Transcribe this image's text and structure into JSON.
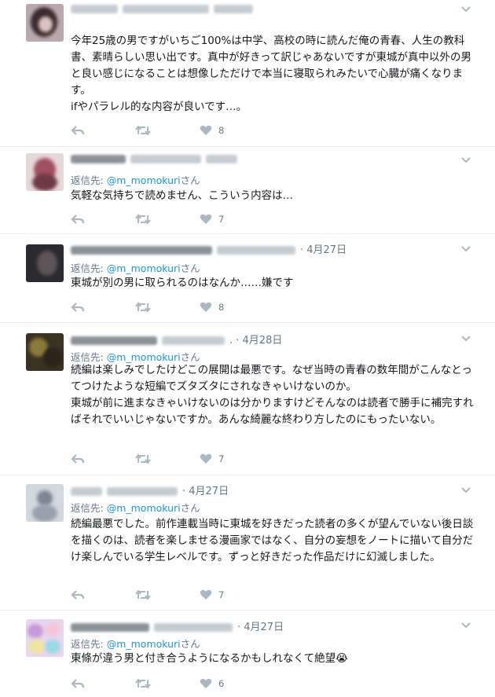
{
  "replies": [
    {
      "date": "",
      "replying_prefix": "",
      "handle": "",
      "handle_suffix": "",
      "text": "今年25歳の男ですがいちご100%は中学、高校の時に読んだ俺の青春、人生の教科書、素晴らしい思い出です。真中が好きって訳じゃあないですが東城が真中以外の男と良い感じになることは想像しただけで本当に寝取られみたいで心臓が痛くなります。\nifやパラレル的な内容が良いです…。",
      "likes": "8"
    },
    {
      "date": "",
      "replying_prefix": "返信先: ",
      "handle": "@m_momokuri",
      "handle_suffix": "さん",
      "text": "気軽な気持ちで読めません、こういう内容は…",
      "likes": "7"
    },
    {
      "date": "4月27日",
      "replying_prefix": "返信先: ",
      "handle": "@m_momokuri",
      "handle_suffix": "さん",
      "text": "東城が別の男に取られるのはなんか……嫌です",
      "likes": "8"
    },
    {
      "date": "4月28日",
      "replying_prefix": "返信先: ",
      "handle": "@m_momokuri",
      "handle_suffix": "さん",
      "text": "続編は楽しみでしたけどこの展開は最悪です。なぜ当時の青春の数年間がこんなとってつけたような短編でズタズタにされなきゃいけないのか。\n東城が前に進まなきゃいけないのは分かりますけどそんなのは読者で勝手に補完すればそれでいいじゃないですか。あんな綺麗な終わり方したのにもったいない。",
      "likes": "7"
    },
    {
      "date": "4月27日",
      "replying_prefix": "返信先: ",
      "handle": "@m_momokuri",
      "handle_suffix": "さん",
      "text": "続編最悪でした。前作連載当時に東城を好きだった読者の多くが望んでいない後日談を描くのは、読者を楽しませる漫画家ではなく、自分の妄想をノートに描いて自分だけ楽しんでいる学生レベルです。ずっと好きだった作品だけに幻滅しました。",
      "likes": "7"
    },
    {
      "date": "4月27日",
      "replying_prefix": "返信先: ",
      "handle": "@m_momokuri",
      "handle_suffix": "さん",
      "text": "東條が違う男と付き合うようになるかもしれなくて絶望😭",
      "likes": "6"
    }
  ],
  "icons": {
    "reply": "reply-icon",
    "retweet": "retweet-icon",
    "like": "heart-icon",
    "more": "chevron-down-icon"
  },
  "colors": {
    "link": "#1b95e0",
    "meta": "#657786",
    "action": "#aab8c2",
    "divider": "#e6ecf0"
  }
}
